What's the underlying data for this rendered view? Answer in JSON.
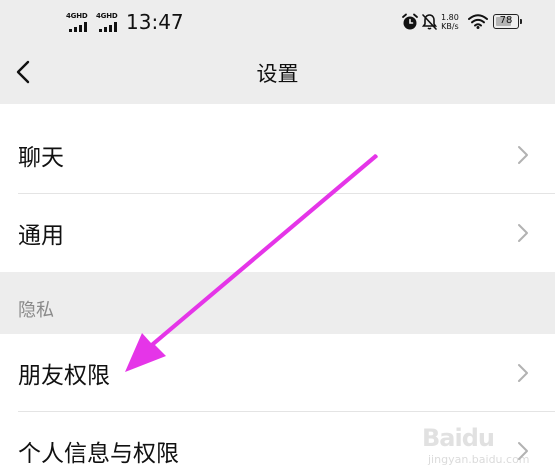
{
  "status_bar": {
    "network1": "4GHD",
    "network2": "4GHD",
    "time": "13:47",
    "speed_value": "1.80",
    "speed_unit": "KB/s",
    "battery_level": "78",
    "battery_fraction": 0.78
  },
  "nav": {
    "title": "设置",
    "back_icon": "chevron-left-icon"
  },
  "rows": {
    "chat": "聊天",
    "general": "通用",
    "friend_permissions": "朋友权限",
    "personal_info": "个人信息与权限"
  },
  "sections": {
    "privacy": "隐私"
  },
  "annotation": {
    "arrow_color": "#e535e8"
  },
  "watermark": {
    "brand": "Baidu",
    "sub": "jingyan.baidu.com"
  }
}
